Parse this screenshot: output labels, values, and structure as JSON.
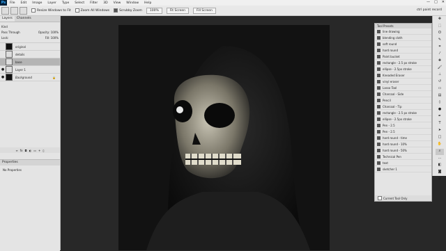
{
  "menubar": {
    "app_logo": "Ps",
    "items": [
      "File",
      "Edit",
      "Image",
      "Layer",
      "Type",
      "Select",
      "Filter",
      "3D",
      "View",
      "Window",
      "Help"
    ],
    "controls": [
      "—",
      "□",
      "✕"
    ]
  },
  "options_bar": {
    "resize_windows_label": "Resize Windows to Fit",
    "zoom_all_label": "Zoom All Windows",
    "scrubby_zoom_label": "Scrubby Zoom",
    "zoom_value": "100%",
    "fit_screen": "Fit Screen",
    "fill_screen": "Fill Screen",
    "right_text": "ctrl paint record"
  },
  "layers_panel": {
    "tabs": [
      "Layers",
      "Channels"
    ],
    "filter_label": "Kind",
    "blend_mode": "Pass Through",
    "opacity_label": "Opacity:",
    "opacity_value": "100%",
    "lock_label": "Lock:",
    "fill_label": "Fill:",
    "fill_value": "100%",
    "layers": [
      {
        "name": "original",
        "visible": false
      },
      {
        "name": "details",
        "visible": false
      },
      {
        "name": "base",
        "visible": false,
        "selected": true
      },
      {
        "name": "Layer 1",
        "visible": true
      },
      {
        "name": "Background",
        "visible": true
      }
    ]
  },
  "properties_panel": {
    "title": "Properties",
    "body": "No Properties"
  },
  "tool_presets": {
    "title": "Tool Presets",
    "items": [
      "line drawing",
      "blending cloth",
      "soft round",
      "hard round",
      "Paint bucket",
      "rectangle - 2.5 px stroke",
      "ellipse - 2.5px stroke",
      "Kneaded Eraser",
      "vinyl eraser",
      "Lasso Tool",
      "Charcoal - Side",
      "Pencil",
      "Charcoal - Tip",
      "rectangle - 2.5 px stroke",
      "ellipse - 2.5px stroke",
      "Pen - 2.5",
      "Pen - 2.5",
      "hard round - time",
      "hard round - 10%",
      "hard round - 50%",
      "Technical Pen",
      "text",
      "sketcher 1"
    ],
    "footer": "Current Tool Only"
  },
  "toolbar": {
    "icons": [
      "move-icon",
      "marquee-icon",
      "lasso-icon",
      "quick-select-icon",
      "crop-icon",
      "eyedropper-icon",
      "healing-icon",
      "brush-icon",
      "stamp-icon",
      "history-brush-icon",
      "eraser-icon",
      "gradient-icon",
      "blur-icon",
      "dodge-icon",
      "pen-icon",
      "type-icon",
      "path-select-icon",
      "shape-icon",
      "hand-icon",
      "zoom-icon",
      "more-icon",
      "colors-icon",
      "quickmask-icon",
      "screenmode-icon"
    ]
  }
}
